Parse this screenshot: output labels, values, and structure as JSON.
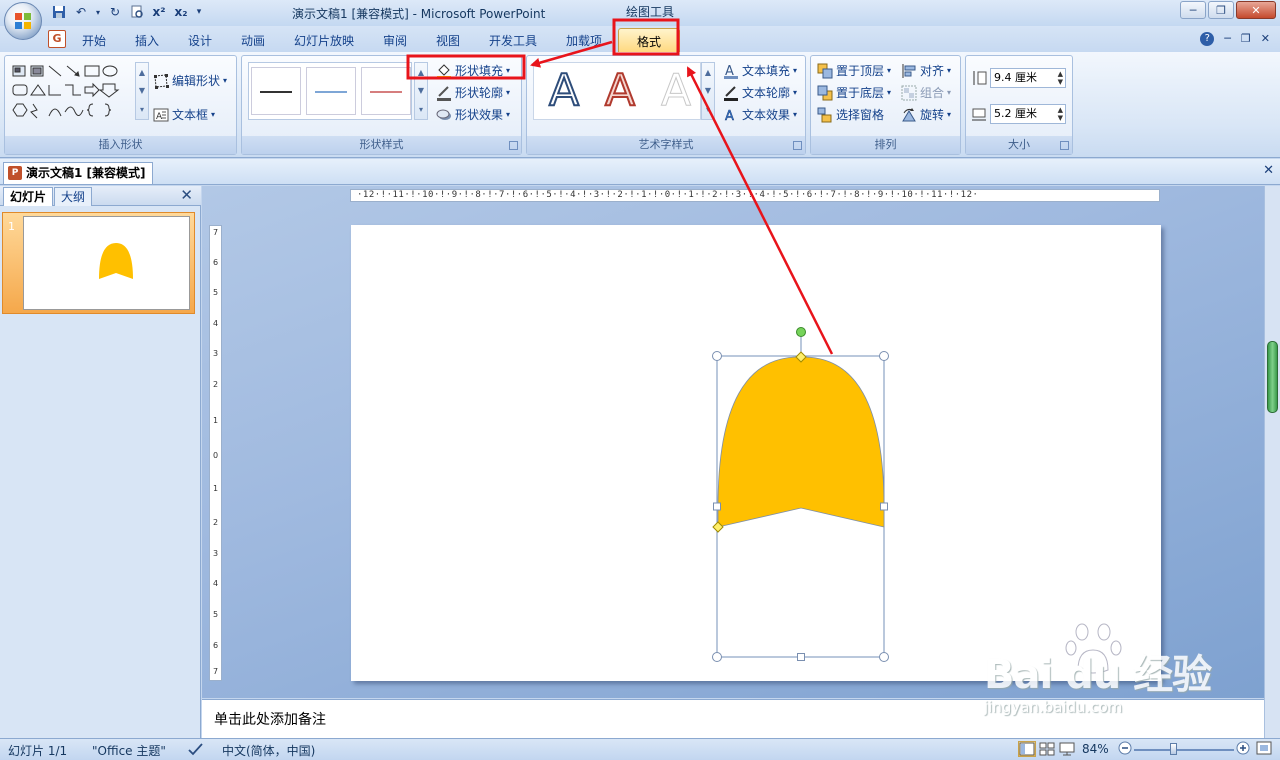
{
  "window": {
    "title": "演示文稿1 [兼容模式] - Microsoft PowerPoint",
    "context_tools": "绘图工具"
  },
  "tabs": [
    {
      "label": "开始"
    },
    {
      "label": "插入"
    },
    {
      "label": "设计"
    },
    {
      "label": "动画"
    },
    {
      "label": "幻灯片放映"
    },
    {
      "label": "审阅"
    },
    {
      "label": "视图"
    },
    {
      "label": "开发工具"
    },
    {
      "label": "加载项"
    },
    {
      "label": "格式"
    }
  ],
  "ribbon": {
    "insert_shapes": {
      "label": "插入形状",
      "edit_shape": "编辑形状",
      "text_box": "文本框"
    },
    "shape_styles": {
      "label": "形状样式",
      "fill": "形状填充",
      "outline": "形状轮廓",
      "effects": "形状效果"
    },
    "wordart_styles": {
      "label": "艺术字样式",
      "sample": "A",
      "text_fill": "文本填充",
      "text_outline": "文本轮廓",
      "text_effects": "文本效果"
    },
    "arrange": {
      "label": "排列",
      "bring_front": "置于顶层",
      "send_back": "置于底层",
      "selection_pane": "选择窗格",
      "align": "对齐",
      "group": "组合",
      "rotate": "旋转"
    },
    "size": {
      "label": "大小",
      "height": "9.4 厘米",
      "width": "5.2 厘米"
    }
  },
  "document_tab": "演示文稿1 [兼容模式]",
  "left_pane": {
    "tab_slides": "幻灯片",
    "tab_outline": "大纲",
    "slide_number": "1"
  },
  "ruler": {
    "horizontal": "·12·!·11·!·10·!·9·!·8·!·7·!·6·!·5·!·4·!·3·!·2·!·1·!·0·!·1·!·2·!·3·!·4·!·5·!·6·!·7·!·8·!·9·!·10·!·11·!·12·",
    "vertical": [
      "7",
      "6",
      "5",
      "4",
      "3",
      "2",
      "1",
      "0",
      "1",
      "2",
      "3",
      "4",
      "5",
      "6",
      "7"
    ]
  },
  "notes": {
    "placeholder": "单击此处添加备注"
  },
  "status": {
    "slide": "幻灯片 1/1",
    "theme": "\"Office 主题\"",
    "language": "中文(简体，中国)",
    "zoom": "84%"
  },
  "watermark": {
    "brand": "Bai du 经验",
    "url": "jingyan.baidu.com"
  },
  "colors": {
    "shape_fill": "#ffc000",
    "annotation": "#e8141b",
    "active_tab": "#ffd980"
  }
}
